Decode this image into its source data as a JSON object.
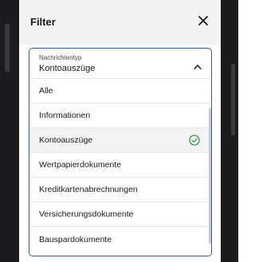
{
  "header": {
    "title": "Filter",
    "close_icon": "close-icon"
  },
  "dropdown": {
    "label": "Nachrichtentyp",
    "value": "Kontoauszüge",
    "chevron_icon": "chevron-up-icon",
    "accent_color": "#2d5fa6",
    "options": [
      {
        "label": "Alle",
        "selected": false
      },
      {
        "label": "Informationen",
        "selected": false
      },
      {
        "label": "Kontoauszüge",
        "selected": true
      },
      {
        "label": "Wertpapierdokumente",
        "selected": false
      },
      {
        "label": "Kreditkartenabrechnungen",
        "selected": false
      },
      {
        "label": "Versicherungsdokumente",
        "selected": false
      },
      {
        "label": "Bauspardokumente",
        "selected": false
      }
    ],
    "selected_icon": "check-circle-icon",
    "selected_icon_color": "#3a9a4a"
  }
}
